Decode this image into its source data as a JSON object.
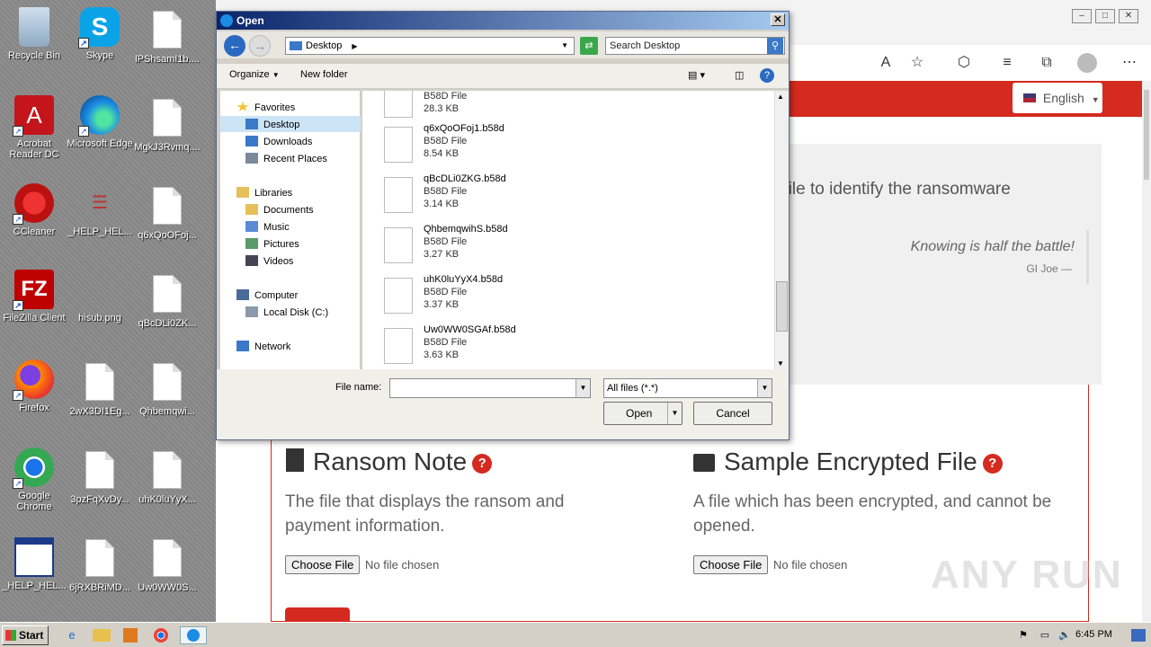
{
  "desktop_icons": [
    {
      "label": "Recycle Bin",
      "icon": "recycle-bin-icon"
    },
    {
      "label": "Skype",
      "icon": "skype-icon"
    },
    {
      "label": "lPShsamI1b....",
      "icon": "file-icon"
    },
    {
      "label": "Acrobat Reader DC",
      "icon": "acrobat-icon"
    },
    {
      "label": "Microsoft Edge",
      "icon": "edge-icon"
    },
    {
      "label": "MgkJ3Rvmq....",
      "icon": "file-icon"
    },
    {
      "label": "CCleaner",
      "icon": "ccleaner-icon"
    },
    {
      "label": "_HELP_HEL...",
      "icon": "help-image-icon"
    },
    {
      "label": "q6xQoOFoj...",
      "icon": "file-icon"
    },
    {
      "label": "FileZilla Client",
      "icon": "filezilla-icon"
    },
    {
      "label": "hisub.png",
      "icon": "png-icon"
    },
    {
      "label": "qBcDLi0ZK...",
      "icon": "file-icon"
    },
    {
      "label": "Firefox",
      "icon": "firefox-icon"
    },
    {
      "label": "2wX3DI1Eg...",
      "icon": "file-icon"
    },
    {
      "label": "Qhbemqwi...",
      "icon": "file-icon"
    },
    {
      "label": "Google Chrome",
      "icon": "chrome-icon"
    },
    {
      "label": "3pzFqXvDy...",
      "icon": "file-icon"
    },
    {
      "label": "uhK0luYyX...",
      "icon": "file-icon"
    },
    {
      "label": "_HELP_HEL...",
      "icon": "window-icon"
    },
    {
      "label": "6jRXBRiMD...",
      "icon": "file-icon"
    },
    {
      "label": "Uw0WW0S...",
      "icon": "file-icon"
    }
  ],
  "browser": {
    "language": "English",
    "identify_text": "ed file to identify the ransomware",
    "quote": "Knowing is half the battle!",
    "quote_author": "GI Joe —",
    "ransom_note": {
      "title": "Ransom Note",
      "desc": "The file that displays the ransom and payment information.",
      "button": "Choose File",
      "status": "No file chosen"
    },
    "sample_file": {
      "title": "Sample Encrypted File",
      "desc": "A file which has been encrypted, and cannot be opened.",
      "button": "Choose File",
      "status": "No file chosen"
    },
    "watermark": "ANY RUN"
  },
  "dialog": {
    "title": "Open",
    "location": "Desktop",
    "search_placeholder": "Search Desktop",
    "organize": "Organize",
    "new_folder": "New folder",
    "nav": {
      "favorites": "Favorites",
      "desktop": "Desktop",
      "downloads": "Downloads",
      "recent": "Recent Places",
      "libraries": "Libraries",
      "documents": "Documents",
      "music": "Music",
      "pictures": "Pictures",
      "videos": "Videos",
      "computer": "Computer",
      "local_disk": "Local Disk (C:)",
      "network": "Network"
    },
    "files": [
      {
        "name": "",
        "type": "B58D File",
        "size": "28.3 KB"
      },
      {
        "name": "q6xQoOFoj1.b58d",
        "type": "B58D File",
        "size": "8.54 KB"
      },
      {
        "name": "qBcDLi0ZKG.b58d",
        "type": "B58D File",
        "size": "3.14 KB"
      },
      {
        "name": "QhbemqwihS.b58d",
        "type": "B58D File",
        "size": "3.27 KB"
      },
      {
        "name": "uhK0luYyX4.b58d",
        "type": "B58D File",
        "size": "3.37 KB"
      },
      {
        "name": "Uw0WW0SGAf.b58d",
        "type": "B58D File",
        "size": "3.63 KB"
      }
    ],
    "filename_label": "File name:",
    "filename_value": "",
    "filter": "All files (*.*)",
    "open": "Open",
    "cancel": "Cancel"
  },
  "taskbar": {
    "start": "Start",
    "clock": "6:45 PM"
  },
  "colors": {
    "accent_red": "#d42a1f"
  }
}
